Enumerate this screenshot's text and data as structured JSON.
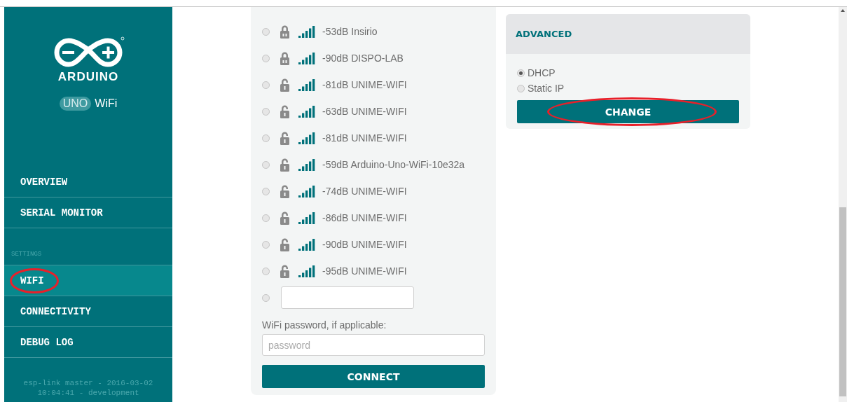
{
  "sidebar": {
    "brand": "ARDUINO",
    "model_badge": "UNO",
    "model_suffix": "WiFi",
    "sections": [
      {
        "items": [
          {
            "label": "OVERVIEW",
            "selected": false,
            "circled": false
          },
          {
            "label": "SERIAL MONITOR",
            "selected": false,
            "circled": false
          }
        ]
      },
      {
        "heading": "SETTINGS",
        "items": [
          {
            "label": "WIFI",
            "selected": true,
            "circled": true
          },
          {
            "label": "CONNECTIVITY",
            "selected": false,
            "circled": false
          },
          {
            "label": "DEBUG LOG",
            "selected": false,
            "circled": false
          }
        ]
      }
    ],
    "footer": "esp-link master - 2016-03-02 10:04:41 - development"
  },
  "networks": [
    {
      "signal": "-53dB",
      "ssid": "Insirio",
      "locked": true,
      "selected": false
    },
    {
      "signal": "-90dB",
      "ssid": "DISPO-LAB",
      "locked": true,
      "selected": false
    },
    {
      "signal": "-81dB",
      "ssid": "UNIME-WIFI",
      "locked": false,
      "selected": false
    },
    {
      "signal": "-63dB",
      "ssid": "UNIME-WIFI",
      "locked": false,
      "selected": false
    },
    {
      "signal": "-81dB",
      "ssid": "UNIME-WIFI",
      "locked": false,
      "selected": false
    },
    {
      "signal": "-59dB",
      "ssid": "Arduino-Uno-WiFi-10e32a",
      "locked": false,
      "selected": false
    },
    {
      "signal": "-74dB",
      "ssid": "UNIME-WIFI",
      "locked": false,
      "selected": false
    },
    {
      "signal": "-86dB",
      "ssid": "UNIME-WIFI",
      "locked": false,
      "selected": false
    },
    {
      "signal": "-90dB",
      "ssid": "UNIME-WIFI",
      "locked": false,
      "selected": false
    },
    {
      "signal": "-95dB",
      "ssid": "UNIME-WIFI",
      "locked": false,
      "selected": false
    }
  ],
  "custom_network": {
    "selected": false
  },
  "password": {
    "label": "WiFi password, if applicable:",
    "placeholder": "password"
  },
  "connect_button": {
    "label": "CONNECT"
  },
  "advanced": {
    "title": "ADVANCED",
    "options": [
      {
        "label": "DHCP",
        "selected": true
      },
      {
        "label": "Static IP",
        "selected": false
      }
    ],
    "button": {
      "label": "CHANGE",
      "circled": true
    }
  }
}
